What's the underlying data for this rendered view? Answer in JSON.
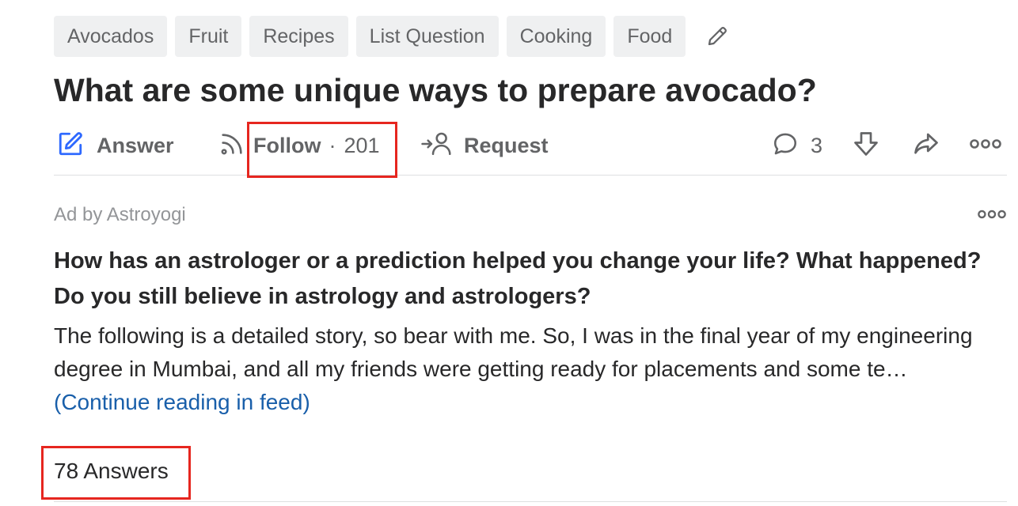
{
  "topics": [
    "Avocados",
    "Fruit",
    "Recipes",
    "List Question",
    "Cooking",
    "Food"
  ],
  "question": {
    "title": "What are some unique ways to prepare avocado?"
  },
  "actions": {
    "answer_label": "Answer",
    "follow_label": "Follow",
    "follow_separator": "·",
    "follow_count": "201",
    "request_label": "Request",
    "comment_count": "3"
  },
  "ad": {
    "label": "Ad by Astroyogi",
    "title": "How has an astrologer or a prediction helped you change your life? What happened? Do you still believe in astrology and astrologers?",
    "body": "The following is a detailed story, so bear with me. So, I was in the final year of my engineering degree in Mumbai, and all my friends were getting ready for placements and some te…",
    "continue_label": "(Continue reading in feed)"
  },
  "answers": {
    "count_label": "78 Answers"
  },
  "colors": {
    "accent_blue": "#2e69ff",
    "link": "#195faa",
    "highlight": "#e6261f",
    "muted": "#636466"
  },
  "icons": [
    "pencil-icon",
    "answer-edit-icon",
    "follow-rss-icon",
    "request-person-icon",
    "comment-icon",
    "downvote-icon",
    "share-icon",
    "more-icon"
  ]
}
